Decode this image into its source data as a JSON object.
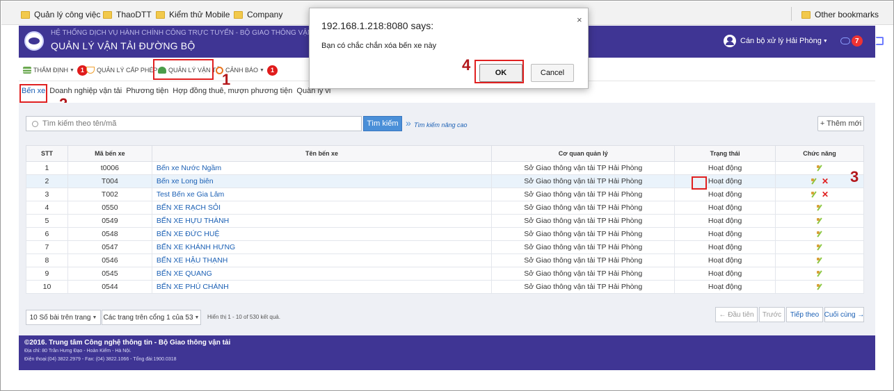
{
  "bookmarks": {
    "items": [
      "Quản lý công việc",
      "ThaoDTT",
      "Kiểm thử Mobile",
      "Company"
    ],
    "other": "Other bookmarks"
  },
  "header": {
    "subtitle": "HỆ THỐNG DỊCH VỤ HÀNH CHÍNH CÔNG TRỰC TUYẾN - BỘ GIAO THÔNG VẬN",
    "title": "QUẢN LÝ VẬN TẢI ĐƯỜNG BỘ",
    "user_label": "Cán bộ xử lý Hải Phòng",
    "notifications": "7"
  },
  "menu": [
    {
      "label": "THẨM ĐỊNH",
      "badge": "1"
    },
    {
      "label": "QUẢN LÝ CẤP PHÉP",
      "badge": ""
    },
    {
      "label": "QUẢN LÝ VẬN TẢI",
      "badge": ""
    },
    {
      "label": "CẢNH BÁO",
      "badge": "1"
    }
  ],
  "submenu": [
    "Bến xe",
    "Doanh nghiệp vận tải",
    "Phương tiện",
    "Hợp đồng thuê, mượn phương tiện",
    "Quản lý vi"
  ],
  "steps": [
    "1",
    "2",
    "3",
    "4"
  ],
  "search": {
    "placeholder": "Tìm kiếm theo tên/mã",
    "button": "Tìm kiếm",
    "advanced_arrow": "»",
    "advanced": "Tìm kiếm nâng cao",
    "add_button": "+ Thêm mới"
  },
  "table": {
    "headers": [
      "STT",
      "Mã bến xe",
      "Tên bến xe",
      "Cơ quan quản lý",
      "Trạng thái",
      "Chức năng"
    ],
    "rows": [
      {
        "stt": "1",
        "code": "t0006",
        "name": "Bến xe Nước Ngầm",
        "agency": "Sở Giao thông vận tải TP Hải Phòng",
        "status": "Hoạt động",
        "delete": false
      },
      {
        "stt": "2",
        "code": "T004",
        "name": "Bến xe Long biên",
        "agency": "Sở Giao thông vận tải TP Hải Phòng",
        "status": "Hoạt động",
        "delete": true
      },
      {
        "stt": "3",
        "code": "T002",
        "name": "Test Bến xe Gia Lâm",
        "agency": "Sở Giao thông vận tải TP Hải Phòng",
        "status": "Hoạt động",
        "delete": true
      },
      {
        "stt": "4",
        "code": "0550",
        "name": "BẾN XE RẠCH SỎI",
        "agency": "Sở Giao thông vận tải TP Hải Phòng",
        "status": "Hoạt động",
        "delete": false
      },
      {
        "stt": "5",
        "code": "0549",
        "name": "BẾN XE HỰU THÀNH",
        "agency": "Sở Giao thông vận tải TP Hải Phòng",
        "status": "Hoạt động",
        "delete": false
      },
      {
        "stt": "6",
        "code": "0548",
        "name": "BẾN XE ĐỨC HUỆ",
        "agency": "Sở Giao thông vận tải TP Hải Phòng",
        "status": "Hoạt động",
        "delete": false
      },
      {
        "stt": "7",
        "code": "0547",
        "name": "BẾN XE KHÁNH HƯNG",
        "agency": "Sở Giao thông vận tải TP Hải Phòng",
        "status": "Hoạt động",
        "delete": false
      },
      {
        "stt": "8",
        "code": "0546",
        "name": "BẾN XE HẬU THẠNH",
        "agency": "Sở Giao thông vận tải TP Hải Phòng",
        "status": "Hoạt động",
        "delete": false
      },
      {
        "stt": "9",
        "code": "0545",
        "name": "BẾN XE QUANG",
        "agency": "Sở Giao thông vận tải TP Hải Phòng",
        "status": "Hoạt động",
        "delete": false
      },
      {
        "stt": "10",
        "code": "0544",
        "name": "BẾN XE PHÚ CHÁNH",
        "agency": "Sở Giao thông vận tải TP Hải Phòng",
        "status": "Hoạt động",
        "delete": false
      }
    ]
  },
  "pager": {
    "per_page": "10 Số bài trên trang",
    "pages": "Các trang trên cổng 1 của 53",
    "info": "Hiển thị 1 - 10 of 530 kết quả.",
    "first": "← Đầu tiên",
    "prev": "Trước",
    "next": "Tiếp theo",
    "last": "Cuối cùng →"
  },
  "footer": {
    "line1": "©2016. Trung tâm Công nghệ thông tin - Bộ Giao thông vận tải",
    "line2": "Địa chỉ: 80 Trần Hưng Đạo - Hoàn Kiếm - Hà Nội.",
    "line3": "Điện thoại:(04) 3822.2979 - Fax: (04) 3822.1066 - Tổng đài:1900.0318"
  },
  "dialog": {
    "title": "192.168.1.218:8080 says:",
    "close": "×",
    "message": "Bạn có chắc chắn xóa bến xe này",
    "ok": "OK",
    "cancel": "Cancel"
  },
  "icons": {
    "edit": "edit-pencil-icon",
    "delete": "delete-x-icon",
    "folder": "folder-icon",
    "search": "search-icon",
    "user": "user-icon"
  },
  "colors": {
    "header_bg": "#3f3594",
    "accent_blue": "#4a8fd8",
    "annotation_red": "#e02020"
  }
}
